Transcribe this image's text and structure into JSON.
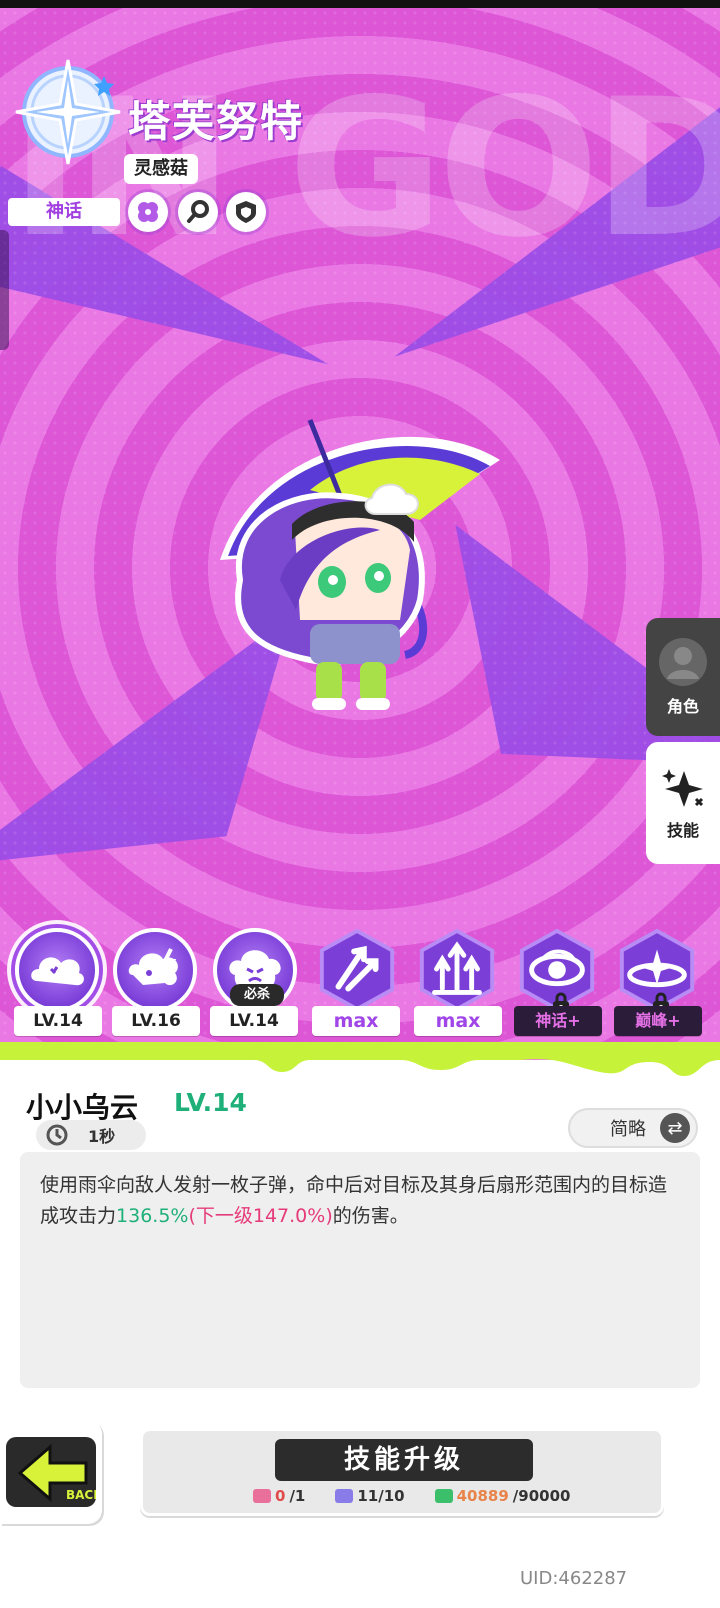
{
  "header": {
    "watermark": "IN GOD",
    "character_name": "塔芙努特",
    "subtitle": "灵感菇",
    "rarity": "神话",
    "traits": [
      "clover-icon",
      "magnifier-icon",
      "shield-icon"
    ]
  },
  "side_tabs": [
    {
      "label": "角色",
      "icon": "avatar-icon",
      "selected": false
    },
    {
      "label": "技能",
      "icon": "sparkle-icon",
      "selected": true
    }
  ],
  "skills": [
    {
      "icon": "cloud-burst-skill-icon",
      "level": "LV.14",
      "selected": true
    },
    {
      "icon": "storm-cloud-skill-icon",
      "level": "LV.16"
    },
    {
      "icon": "angry-cloud-skill-icon",
      "level": "LV.14",
      "tag": "必杀"
    },
    {
      "icon": "split-arrow-skill-icon",
      "level": "max"
    },
    {
      "icon": "triple-arrow-skill-icon",
      "level": "max"
    },
    {
      "icon": "swirl-skill-icon",
      "level": "神话+",
      "locked": true
    },
    {
      "icon": "ring-star-skill-icon",
      "level": "巅峰+",
      "locked": true
    }
  ],
  "detail": {
    "name": "小小乌云",
    "level": "LV.14",
    "cooldown": "1秒",
    "mode_button": "简略",
    "desc_before": "使用雨伞向敌人发射一枚子弹，命中后对目标及其身后扇形范围内的目标造成攻击力",
    "desc_value": "136.5%",
    "desc_next": "(下一级147.0%)",
    "desc_after": "的伤害。"
  },
  "footer": {
    "back_label": "BACK",
    "upgrade_label": "技能升级",
    "costs": {
      "ticket": {
        "have": "0",
        "need": "/1"
      },
      "book": {
        "have": "11/10"
      },
      "coin": {
        "have": "40889",
        "need": "/90000"
      }
    },
    "uid": "UID:462287"
  },
  "colors": {
    "background": "#e157d8",
    "accent_purple": "#9c4de6",
    "level_green": "#1fb07a",
    "next_level_pink": "#e63b7a"
  }
}
